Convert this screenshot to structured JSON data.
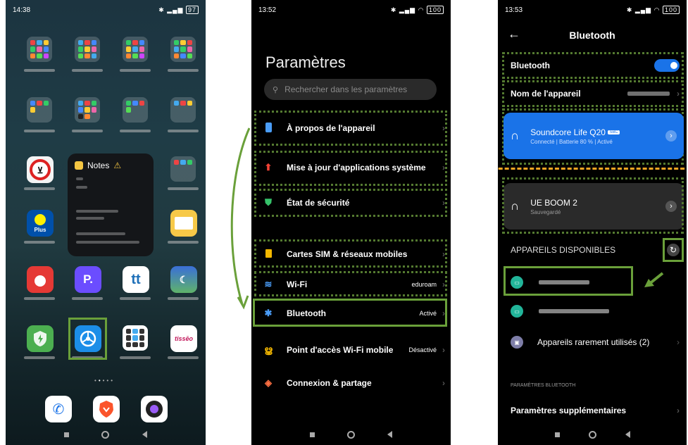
{
  "home": {
    "time": "14:38",
    "battery": "97",
    "notes_title": "Notes",
    "notes_warning": "⚠",
    "lidl_label": "Lidl\nPlus",
    "tutti_label": "tt",
    "tisseo_label": "tissēo",
    "p_label": "P."
  },
  "settings": {
    "time": "13:52",
    "battery": "100",
    "title": "Paramètres",
    "search_placeholder": "Rechercher dans les paramètres",
    "items": [
      {
        "label": "À propos de l'appareil",
        "value": ""
      },
      {
        "label": "Mise à jour d'applications système",
        "value": ""
      },
      {
        "label": "État de sécurité",
        "value": ""
      },
      {
        "label": "Cartes SIM & réseaux mobiles",
        "value": ""
      },
      {
        "label": "Wi-Fi",
        "value": "eduroam"
      },
      {
        "label": "Bluetooth",
        "value": "Activé"
      },
      {
        "label": "Point d'accès Wi-Fi mobile",
        "value": "Désactivé"
      },
      {
        "label": "Connexion & partage",
        "value": ""
      }
    ]
  },
  "bluetooth": {
    "time": "13:53",
    "battery": "100",
    "title": "Bluetooth",
    "toggle_label": "Bluetooth",
    "device_name_label": "Nom de l'appareil",
    "connected_device": "Soundcore Life Q20",
    "codec_badge": "SBC",
    "connected_status": "Connecté | Batterie 80 % | Activé",
    "saved_device": "UE BOOM 2",
    "saved_status": "Sauvegardé",
    "available_header": "APPAREILS DISPONIBLES",
    "rare_devices": "Appareils rarement utilisés (2)",
    "settings_header": "PARAMÈTRES BLUETOOTH",
    "more_settings": "Paramètres supplémentaires"
  },
  "colors": {
    "highlight": "#6aa03a",
    "accent_blue": "#1a73e8",
    "annotation_orange": "#f5a623"
  }
}
